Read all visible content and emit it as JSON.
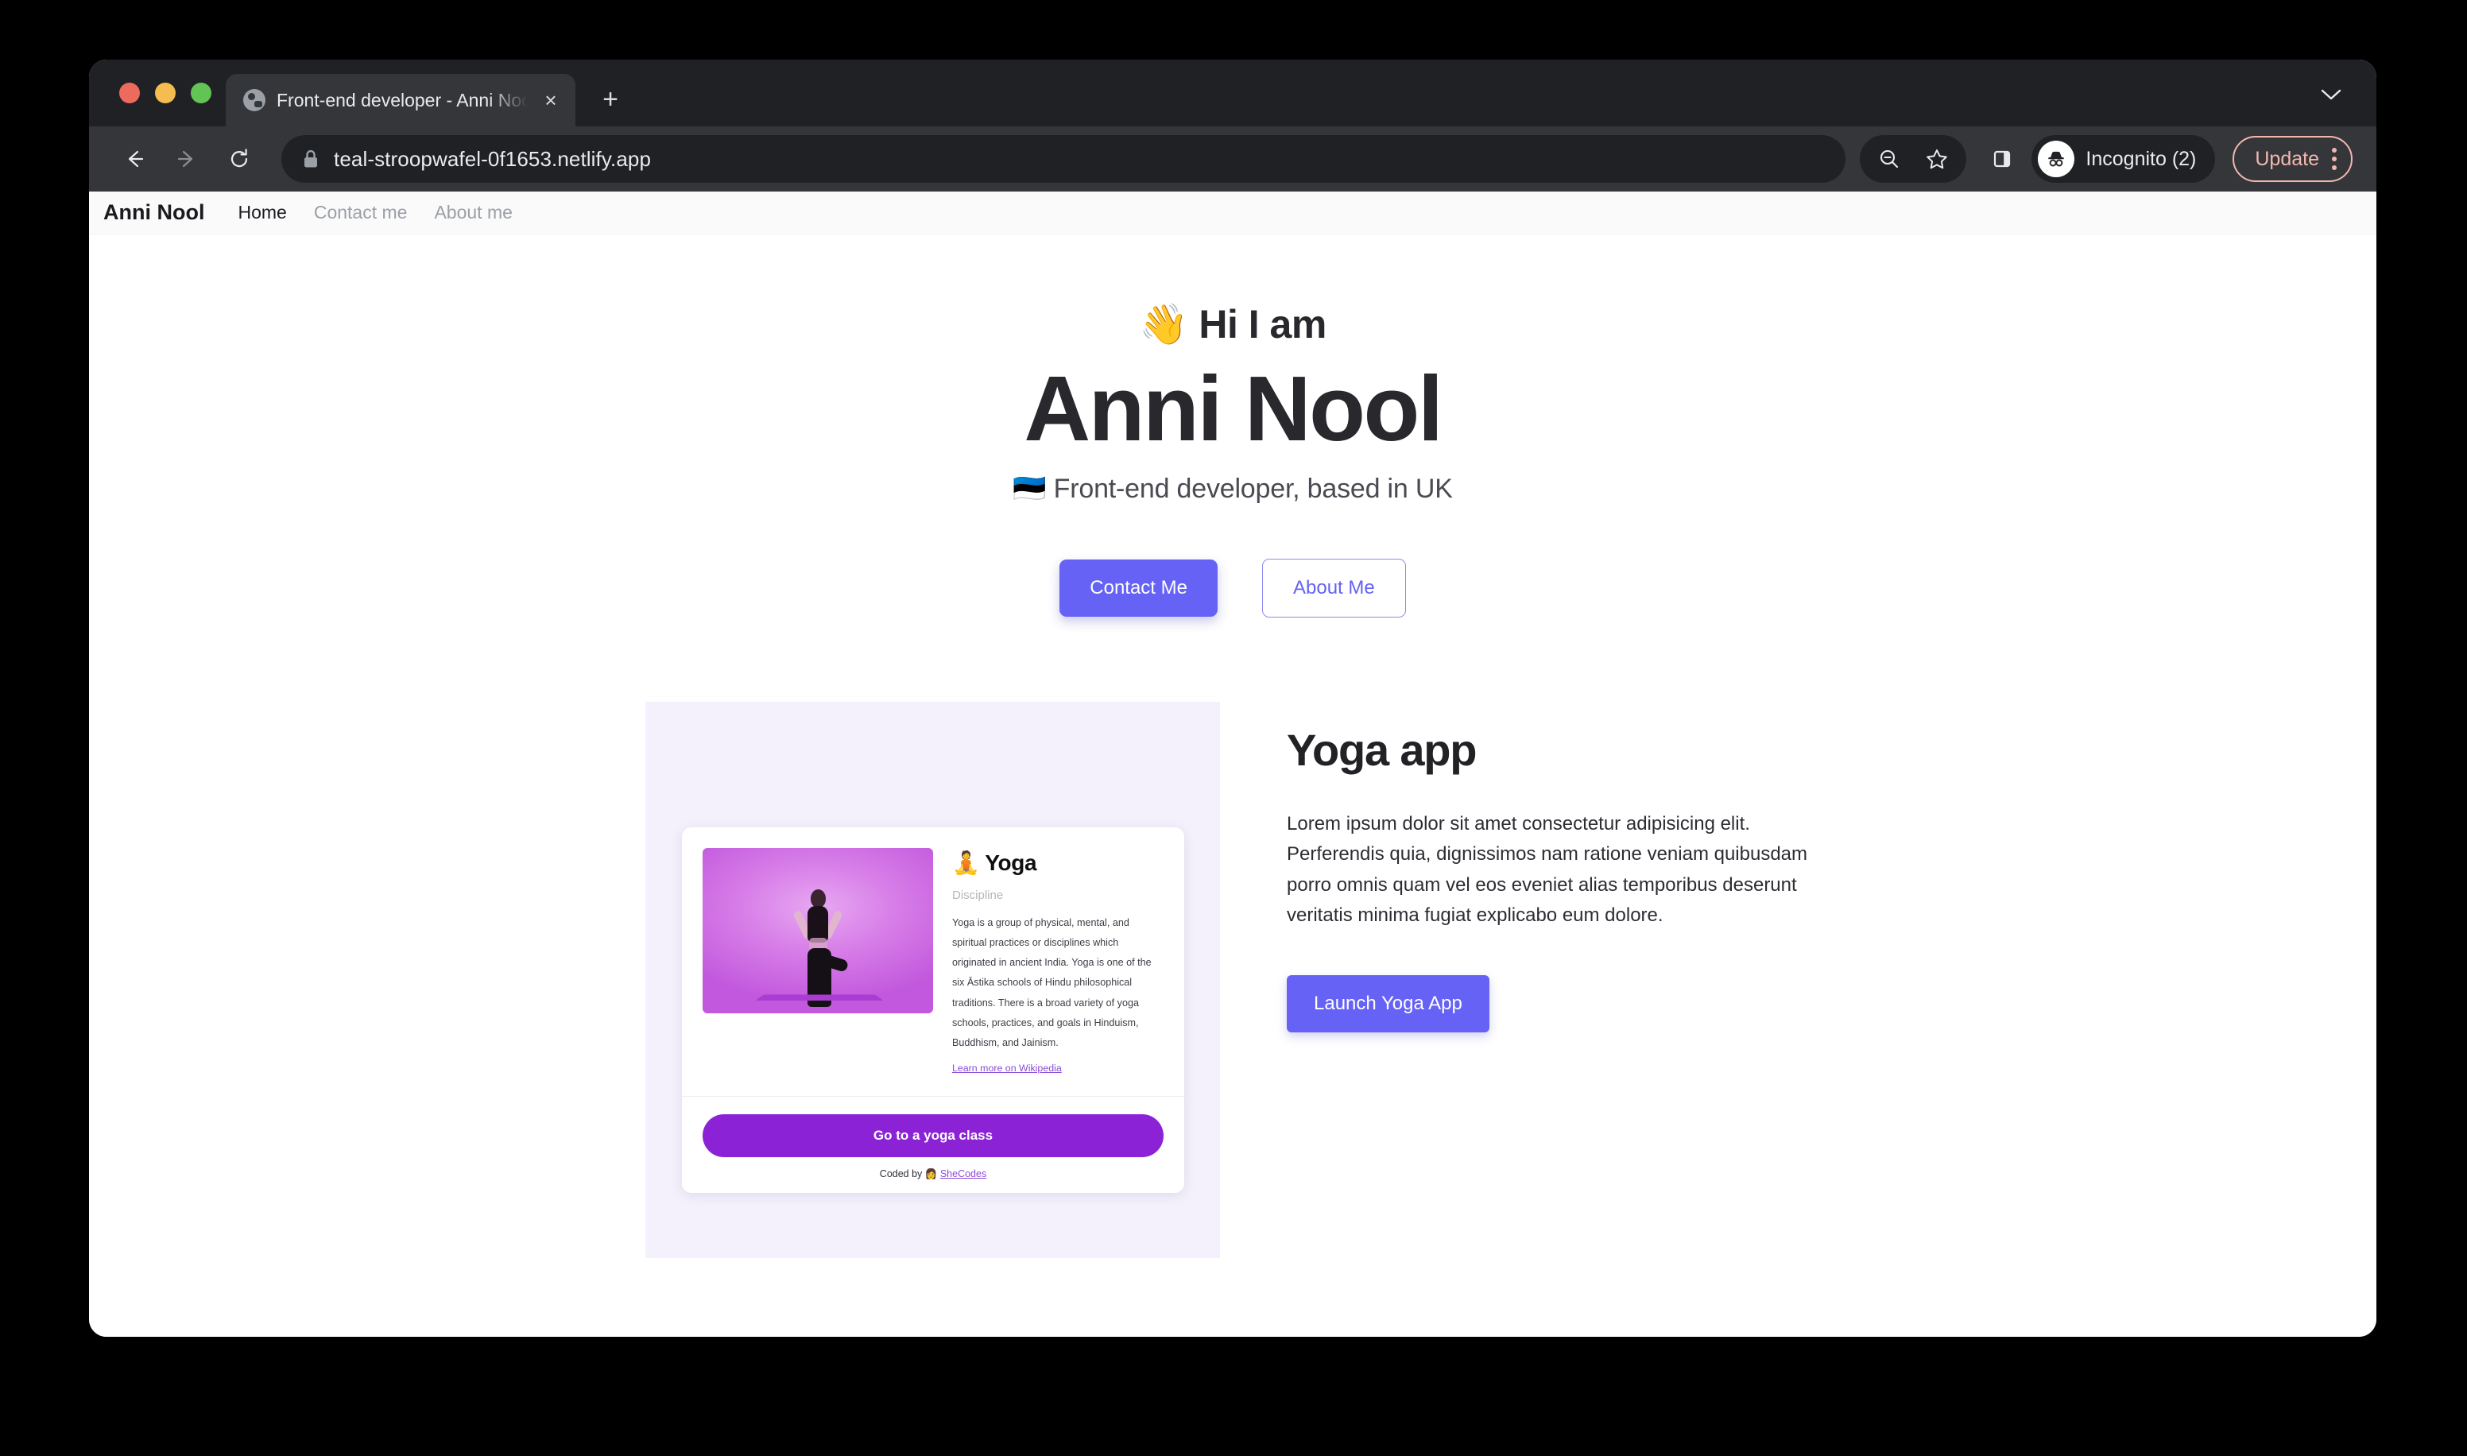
{
  "browser": {
    "tab": {
      "title": "Front-end developer - Anni Noo",
      "close_label": "×",
      "favicon": "globe-icon"
    },
    "new_tab_label": "+",
    "window_chevron": "⌄",
    "nav": {
      "back": "←",
      "forward": "→",
      "reload": "↻"
    },
    "omnibox": {
      "url": "teal-stroopwafel-0f1653.netlify.app",
      "lock_icon": "lock-icon"
    },
    "toolbar_right": {
      "zoom_out_icon": "zoom-out-magnifier-icon",
      "bookmark_icon": "star-icon",
      "side_panel_icon": "side-panel-icon",
      "incognito_label": "Incognito (2)",
      "update_label": "Update",
      "menu_icon": "kebab-menu-icon"
    },
    "traffic_lights": {
      "close": "#ed6a5e",
      "minimize": "#f5bd4f",
      "maximize": "#61c454"
    }
  },
  "site": {
    "nav": {
      "brand": "Anni Nool",
      "links": [
        {
          "label": "Home",
          "active": true
        },
        {
          "label": "Contact me",
          "active": false
        },
        {
          "label": "About me",
          "active": false
        }
      ]
    },
    "hero": {
      "greeting": "👋 Hi I am",
      "name": "Anni Nool",
      "subtitle": "🇪🇪 Front-end developer, based in UK",
      "primary_button": "Contact Me",
      "secondary_button": "About Me"
    },
    "project": {
      "title": "Yoga app",
      "paragraph": "Lorem ipsum dolor sit amet consectetur adipisicing elit. Perferendis quia, dignissimos nam ratione veniam quibusdam porro omnis quam vel eos eveniet alias temporibus deserunt veritatis minima fugiat explicabo eum dolore.",
      "launch_button": "Launch Yoga App",
      "preview": {
        "title": "🧘 Yoga",
        "subtitle": "Discipline",
        "description": "Yoga is a group of physical, mental, and spiritual practices or disciplines which originated in ancient India. Yoga is one of the six Āstika schools of Hindu philosophical traditions. There is a broad variety of yoga schools, practices, and goals in Hinduism, Buddhism, and Jainism.",
        "wiki_link": "Learn more on Wikipedia",
        "cta_button": "Go to a yoga class",
        "footer_prefix": "Coded by 👩 ",
        "footer_link": "SheCodes",
        "photo_alt": "woman-in-tree-pose-photo"
      }
    }
  },
  "colors": {
    "accent": "#6562f5",
    "yoga_purple": "#8b22d6",
    "panel_lavender": "#f4f1fc",
    "update_pink": "#f2b8b0"
  }
}
